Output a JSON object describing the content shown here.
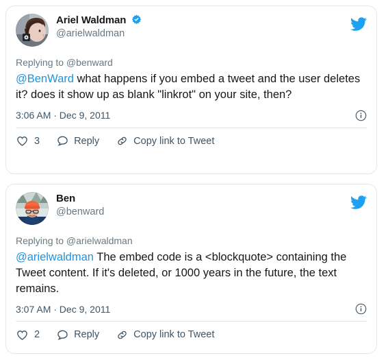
{
  "brand": {
    "link_color": "#1b95e0",
    "verified_color": "#1da1f2",
    "text_color": "#14171a",
    "muted_color": "#697882",
    "border_color": "#e1e8ed",
    "bird_icon": "twitter-bird-icon"
  },
  "tweets": [
    {
      "author": {
        "display_name": "Ariel Waldman",
        "handle": "@arielwaldman",
        "verified": true,
        "avatar_alt": "ariel-waldman-avatar"
      },
      "replying_to": "Replying to @benward",
      "text_mention": "@BenWard",
      "text_body": " what happens if you embed a tweet and the user deletes it? does it show up as blank \"linkrot\" on your site, then?",
      "timestamp": "3:06 AM · Dec 9, 2011",
      "info_label": "info-icon",
      "actions": {
        "like_count": "3",
        "reply_label": "Reply",
        "copy_label": "Copy link to Tweet"
      }
    },
    {
      "author": {
        "display_name": "Ben",
        "handle": "@benward",
        "verified": false,
        "avatar_alt": "ben-ward-avatar"
      },
      "replying_to": "Replying to @arielwaldman",
      "text_mention": "@arielwaldman",
      "text_body": " The embed code is a <blockquote> containing the Tweet content. If it's deleted, or 1000 years in the future, the text remains.",
      "timestamp": "3:07 AM · Dec 9, 2011",
      "info_label": "info-icon",
      "actions": {
        "like_count": "2",
        "reply_label": "Reply",
        "copy_label": "Copy link to Tweet"
      }
    }
  ]
}
